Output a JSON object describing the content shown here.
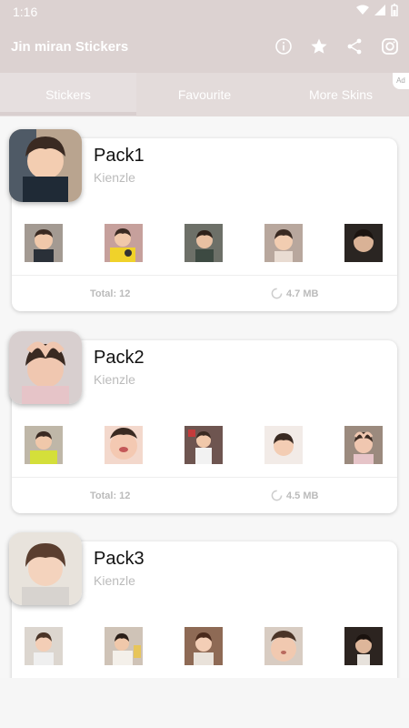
{
  "status": {
    "time": "1:16"
  },
  "app": {
    "title": "Jin miran Stickers"
  },
  "tabs": [
    {
      "label": "Stickers"
    },
    {
      "label": "Favourite"
    },
    {
      "label": "More Skins"
    }
  ],
  "ad_label": "Ad",
  "packs": [
    {
      "name": "Pack1",
      "author": "Kienzle",
      "total": "Total: 12",
      "size": "4.7 MB"
    },
    {
      "name": "Pack2",
      "author": "Kienzle",
      "total": "Total: 12",
      "size": "4.5 MB"
    },
    {
      "name": "Pack3",
      "author": "Kienzle"
    }
  ],
  "colors": {
    "accent": "#dcd2d1",
    "card_bg": "#ffffff",
    "muted_text": "#bbbbbb"
  },
  "icons": [
    "wifi-icon",
    "signal-icon",
    "battery-icon",
    "info-icon",
    "star-icon",
    "share-icon",
    "instagram-icon"
  ]
}
